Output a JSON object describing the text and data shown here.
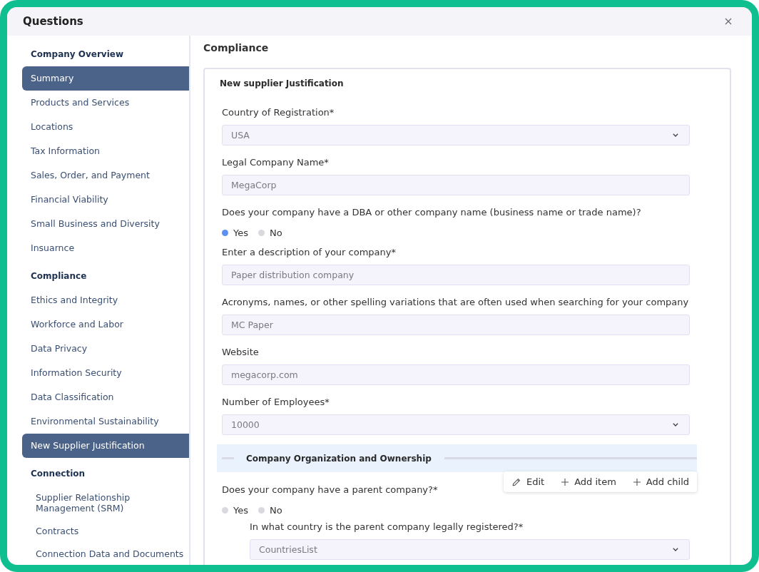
{
  "window": {
    "title": "Questions"
  },
  "sidebar": {
    "groups": [
      {
        "title": "Company Overview",
        "indented": false,
        "items": [
          {
            "label": "Summary",
            "selected": true
          },
          {
            "label": "Products and Services",
            "selected": false
          },
          {
            "label": "Locations",
            "selected": false
          },
          {
            "label": "Tax Information",
            "selected": false
          },
          {
            "label": "Sales, Order, and Payment",
            "selected": false
          },
          {
            "label": "Financial Viability",
            "selected": false
          },
          {
            "label": "Small Business and Diversity",
            "selected": false
          },
          {
            "label": "Insuarnce",
            "selected": false
          }
        ]
      },
      {
        "title": "Compliance",
        "indented": false,
        "items": [
          {
            "label": "Ethics and Integrity",
            "selected": false
          },
          {
            "label": "Workforce and Labor",
            "selected": false
          },
          {
            "label": "Data Privacy",
            "selected": false
          },
          {
            "label": "Information Security",
            "selected": false
          },
          {
            "label": "Data Classification",
            "selected": false
          },
          {
            "label": "Environmental Sustainability",
            "selected": false
          },
          {
            "label": "New Supplier Justification",
            "selected": true
          }
        ]
      },
      {
        "title": "Connection",
        "indented": true,
        "items": [
          {
            "label": "Supplier Relationship Management (SRM)",
            "selected": false
          },
          {
            "label": "Contracts",
            "selected": false
          },
          {
            "label": "Connection Data and Documents",
            "selected": false
          }
        ]
      }
    ]
  },
  "main": {
    "heading": "Compliance",
    "card": {
      "title": "New supplier Justification",
      "fields": [
        {
          "kind": "select",
          "label": "Country of Registration*",
          "value": "USA"
        },
        {
          "kind": "text",
          "label": "Legal Company Name*",
          "value": "MegaCorp"
        },
        {
          "kind": "radio",
          "label": "Does your company have a DBA or other company name (business name or trade name)?",
          "options": [
            {
              "label": "Yes",
              "selected": true
            },
            {
              "label": "No",
              "selected": false
            }
          ]
        },
        {
          "kind": "text",
          "label": "Enter a description of your company*",
          "value": "Paper distribution company"
        },
        {
          "kind": "text",
          "label": "Acronyms, names, or other spelling variations that are often used when searching for your company",
          "value": "MC Paper"
        },
        {
          "kind": "text",
          "label": "Website",
          "value": "megacorp.com"
        },
        {
          "kind": "select",
          "label": "Number of Employees*",
          "value": "10000"
        }
      ],
      "section": {
        "title": "Company Organization and Ownership",
        "actions": [
          {
            "kind": "edit",
            "label": "Edit"
          },
          {
            "kind": "add",
            "label": "Add item"
          },
          {
            "kind": "add",
            "label": "Add child"
          }
        ],
        "fields": [
          {
            "kind": "radio",
            "label": "Does your company have a parent company?*",
            "options": [
              {
                "label": "Yes",
                "selected": false
              },
              {
                "label": "No",
                "selected": false
              }
            ],
            "children": [
              {
                "kind": "select",
                "label": "In what country is the parent company legally registered?*",
                "value": "CountriesList"
              }
            ]
          }
        ]
      }
    }
  }
}
